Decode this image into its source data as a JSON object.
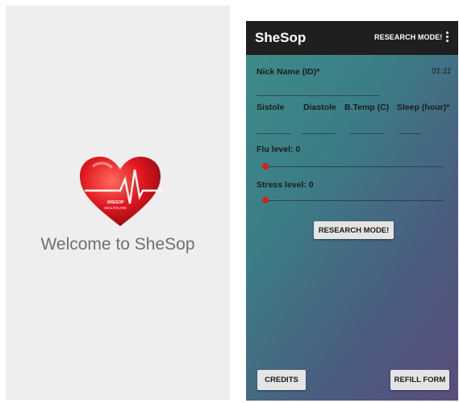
{
  "splash": {
    "welcome_text": "Welcome to SheSop",
    "logo_text_line1": "SHESOP",
    "logo_text_line2": "HEALTHCARE"
  },
  "app": {
    "title": "SheSop",
    "appbar_action": "RESEARCH MODE!",
    "nickname_label": "Nick Name (ID)*",
    "time": "01:11",
    "fields": {
      "sistole": "Sistole",
      "diastole": "Diastole",
      "btemp": "B.Temp (C)",
      "sleep": "Sleep (hour)*"
    },
    "flu_label": "Flu level: 0",
    "flu_value": 0,
    "stress_label": "Stress level: 0",
    "stress_value": 0,
    "research_button": "RESEARCH MODE!",
    "credits_button": "CREDITS",
    "refill_button": "REFILL FORM"
  },
  "colors": {
    "accent": "#d0231e",
    "appbar": "#1f1f1f",
    "splash_bg": "#eeeeee"
  }
}
